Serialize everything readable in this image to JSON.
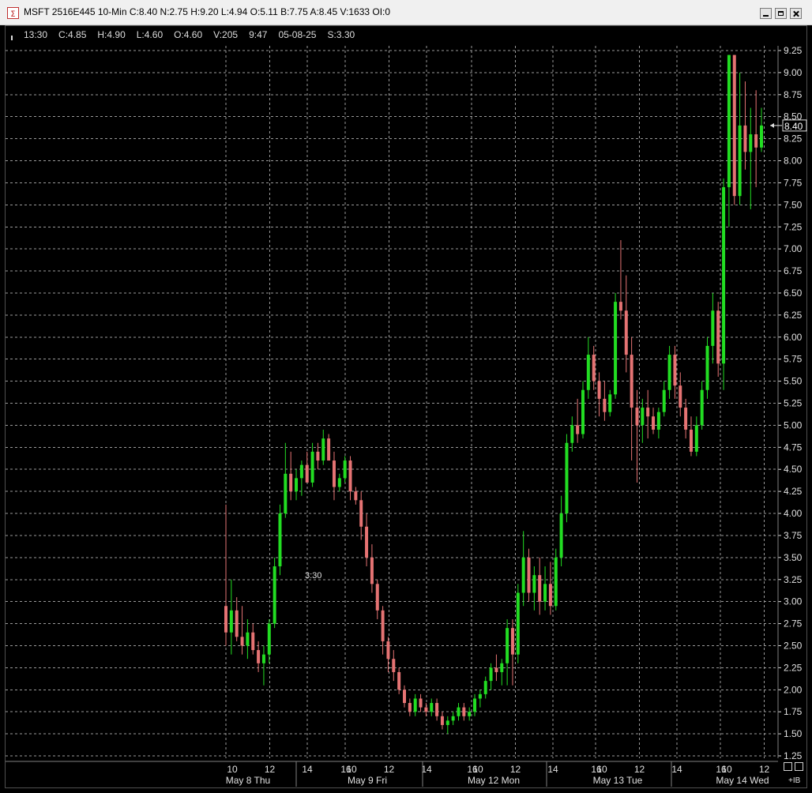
{
  "window": {
    "title": "MSFT 2516E445 10-Min C:8.40 N:2.75 H:9.20 L:4.94 O:5.11 B:7.75 A:8.45 V:1633 OI:0",
    "icon": "ewm-app-icon"
  },
  "info_bar": {
    "time": "13:30",
    "close": "C:4.85",
    "high": "H:4.90",
    "low": "L:4.60",
    "open": "O:4.60",
    "volume": "V:205",
    "clock": "9:47",
    "date": "05-08-25",
    "strike": "S:3.30"
  },
  "strike_label": "3:30",
  "last_price_label": "8.40",
  "bottom_label": "+IB",
  "colors": {
    "up": "#22dd22",
    "down": "#e57373",
    "grid": "#9a9a9a",
    "axis_text": "#e0e0e0",
    "background": "#000000"
  },
  "chart_data": {
    "type": "candlestick",
    "ylim": [
      1.25,
      9.25
    ],
    "y_ticks": [
      "9.25",
      "9.00",
      "8.75",
      "8.50",
      "8.25",
      "8.00",
      "7.75",
      "7.50",
      "7.25",
      "7.00",
      "6.75",
      "6.50",
      "6.25",
      "6.00",
      "5.75",
      "5.50",
      "5.25",
      "5.00",
      "4.75",
      "4.50",
      "4.25",
      "4.00",
      "3.75",
      "3.50",
      "3.25",
      "3.00",
      "2.75",
      "2.50",
      "2.25",
      "2.00",
      "1.75",
      "1.50",
      "1.25"
    ],
    "days": [
      {
        "name": "May 8 Thu",
        "ticks": [
          "10",
          "12",
          "14"
        ]
      },
      {
        "name": "May 9 Fri",
        "ticks": [
          "16",
          "10",
          "12",
          "14"
        ]
      },
      {
        "name": "May 12 Mon",
        "ticks": [
          "16",
          "10",
          "12",
          "14"
        ]
      },
      {
        "name": "May 13 Tue",
        "ticks": [
          "16",
          "10",
          "12",
          "14"
        ]
      },
      {
        "name": "May 14 Wed",
        "ticks": [
          "16",
          "10",
          "12"
        ]
      }
    ],
    "last_price": 8.4,
    "strike": 3.3,
    "bars": [
      [
        2.95,
        4.1,
        2.5,
        2.65
      ],
      [
        2.65,
        3.25,
        2.4,
        2.9
      ],
      [
        2.9,
        3.05,
        2.55,
        2.6
      ],
      [
        2.6,
        2.95,
        2.4,
        2.5
      ],
      [
        2.5,
        2.8,
        2.35,
        2.65
      ],
      [
        2.65,
        2.75,
        2.4,
        2.45
      ],
      [
        2.45,
        2.55,
        2.2,
        2.3
      ],
      [
        2.3,
        2.5,
        2.05,
        2.4
      ],
      [
        2.4,
        2.8,
        2.3,
        2.75
      ],
      [
        2.75,
        3.5,
        2.7,
        3.4
      ],
      [
        3.4,
        4.1,
        3.3,
        4.0
      ],
      [
        4.0,
        4.8,
        3.95,
        4.45
      ],
      [
        4.45,
        4.7,
        4.15,
        4.25
      ],
      [
        4.25,
        4.5,
        4.15,
        4.4
      ],
      [
        4.4,
        4.6,
        4.2,
        4.55
      ],
      [
        4.55,
        4.7,
        4.35,
        4.35
      ],
      [
        4.35,
        4.8,
        4.3,
        4.7
      ],
      [
        4.7,
        4.8,
        4.5,
        4.6
      ],
      [
        4.6,
        4.95,
        4.55,
        4.85
      ],
      [
        4.85,
        4.9,
        4.6,
        4.6
      ],
      [
        4.6,
        4.7,
        4.15,
        4.3
      ],
      [
        4.3,
        4.45,
        4.25,
        4.4
      ],
      [
        4.4,
        4.65,
        4.35,
        4.6
      ],
      [
        4.6,
        4.65,
        4.15,
        4.25
      ],
      [
        4.25,
        4.3,
        4.1,
        4.15
      ],
      [
        4.15,
        4.25,
        3.7,
        3.85
      ],
      [
        3.85,
        4.0,
        3.4,
        3.5
      ],
      [
        3.5,
        3.65,
        3.1,
        3.2
      ],
      [
        3.2,
        3.25,
        2.8,
        2.9
      ],
      [
        2.9,
        2.95,
        2.4,
        2.55
      ],
      [
        2.55,
        2.6,
        2.2,
        2.35
      ],
      [
        2.35,
        2.45,
        2.1,
        2.2
      ],
      [
        2.2,
        2.25,
        1.95,
        2.0
      ],
      [
        2.0,
        2.05,
        1.8,
        1.85
      ],
      [
        1.85,
        1.9,
        1.7,
        1.75
      ],
      [
        1.75,
        1.95,
        1.7,
        1.9
      ],
      [
        1.9,
        1.95,
        1.75,
        1.8
      ],
      [
        1.8,
        1.85,
        1.7,
        1.75
      ],
      [
        1.75,
        1.9,
        1.7,
        1.85
      ],
      [
        1.85,
        1.9,
        1.65,
        1.7
      ],
      [
        1.7,
        1.75,
        1.55,
        1.6
      ],
      [
        1.6,
        1.7,
        1.5,
        1.65
      ],
      [
        1.65,
        1.75,
        1.6,
        1.7
      ],
      [
        1.7,
        1.85,
        1.65,
        1.8
      ],
      [
        1.8,
        1.85,
        1.65,
        1.7
      ],
      [
        1.7,
        1.8,
        1.65,
        1.75
      ],
      [
        1.75,
        1.95,
        1.7,
        1.9
      ],
      [
        1.9,
        2.0,
        1.8,
        1.95
      ],
      [
        1.95,
        2.15,
        1.9,
        2.1
      ],
      [
        2.1,
        2.3,
        2.0,
        2.25
      ],
      [
        2.25,
        2.4,
        2.1,
        2.2
      ],
      [
        2.2,
        2.35,
        2.05,
        2.3
      ],
      [
        2.3,
        2.8,
        2.05,
        2.7
      ],
      [
        2.7,
        2.8,
        2.05,
        2.4
      ],
      [
        2.4,
        3.2,
        2.3,
        3.1
      ],
      [
        3.1,
        3.8,
        2.95,
        3.5
      ],
      [
        3.5,
        3.6,
        3.0,
        3.1
      ],
      [
        3.1,
        3.4,
        2.9,
        3.3
      ],
      [
        3.3,
        3.5,
        2.85,
        3.0
      ],
      [
        3.0,
        3.4,
        2.9,
        3.2
      ],
      [
        3.2,
        3.45,
        2.85,
        2.95
      ],
      [
        2.95,
        3.6,
        2.9,
        3.5
      ],
      [
        3.5,
        4.2,
        3.4,
        4.0
      ],
      [
        4.0,
        4.9,
        3.9,
        4.8
      ],
      [
        4.8,
        5.1,
        4.7,
        5.0
      ],
      [
        5.0,
        5.3,
        4.8,
        4.9
      ],
      [
        4.9,
        5.5,
        4.85,
        5.4
      ],
      [
        5.4,
        6.0,
        5.3,
        5.8
      ],
      [
        5.8,
        5.9,
        5.4,
        5.5
      ],
      [
        5.5,
        5.6,
        5.1,
        5.3
      ],
      [
        5.3,
        5.5,
        5.05,
        5.15
      ],
      [
        5.15,
        5.4,
        5.1,
        5.35
      ],
      [
        5.35,
        6.5,
        5.3,
        6.4
      ],
      [
        6.4,
        7.1,
        6.2,
        6.3
      ],
      [
        6.3,
        6.7,
        5.6,
        5.8
      ],
      [
        5.8,
        6.0,
        4.6,
        5.2
      ],
      [
        5.2,
        5.4,
        4.35,
        5.0
      ],
      [
        5.0,
        5.3,
        4.8,
        5.2
      ],
      [
        5.2,
        5.4,
        4.85,
        5.1
      ],
      [
        5.1,
        5.2,
        4.9,
        4.95
      ],
      [
        4.95,
        5.2,
        4.85,
        5.15
      ],
      [
        5.15,
        5.5,
        5.1,
        5.4
      ],
      [
        5.4,
        5.9,
        5.3,
        5.8
      ],
      [
        5.8,
        5.9,
        5.3,
        5.45
      ],
      [
        5.45,
        5.6,
        5.1,
        5.2
      ],
      [
        5.2,
        5.3,
        4.85,
        4.95
      ],
      [
        4.95,
        5.1,
        4.65,
        4.7
      ],
      [
        4.7,
        5.1,
        4.65,
        5.0
      ],
      [
        5.0,
        5.5,
        4.95,
        5.4
      ],
      [
        5.4,
        6.0,
        5.3,
        5.9
      ],
      [
        5.9,
        6.5,
        5.7,
        6.3
      ],
      [
        6.3,
        6.4,
        5.55,
        5.7
      ],
      [
        5.7,
        7.8,
        5.4,
        7.7
      ],
      [
        7.7,
        9.2,
        7.25,
        9.2
      ],
      [
        9.2,
        9.2,
        7.5,
        7.6
      ],
      [
        7.6,
        9.0,
        7.5,
        8.4
      ],
      [
        8.4,
        8.9,
        7.9,
        8.1
      ],
      [
        8.1,
        8.6,
        7.45,
        8.3
      ],
      [
        8.3,
        8.8,
        7.7,
        8.15
      ],
      [
        8.15,
        8.6,
        8.1,
        8.4
      ]
    ]
  }
}
